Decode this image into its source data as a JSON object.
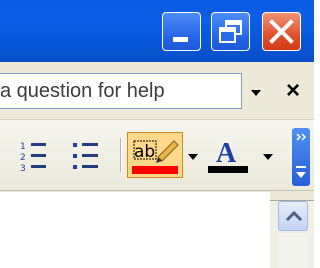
{
  "titlebar": {
    "minimize_label": "Minimize",
    "restore_label": "Restore Down",
    "close_label": "Close"
  },
  "helpbar": {
    "ask_text": "a question for help",
    "dropdown_icon": "chevron-down-icon",
    "close_glyph": "×"
  },
  "toolbar": {
    "numbering_icon": "numbered-list-icon",
    "bullets_icon": "bulleted-list-icon",
    "highlight_text": "ab",
    "highlight_color": "#ff0000",
    "font_color_letter": "A",
    "font_color": "#000000"
  },
  "colors": {
    "titlebar": "#0b5fe6",
    "menubar": "#ece9d8",
    "close_button": "#e1502d"
  }
}
